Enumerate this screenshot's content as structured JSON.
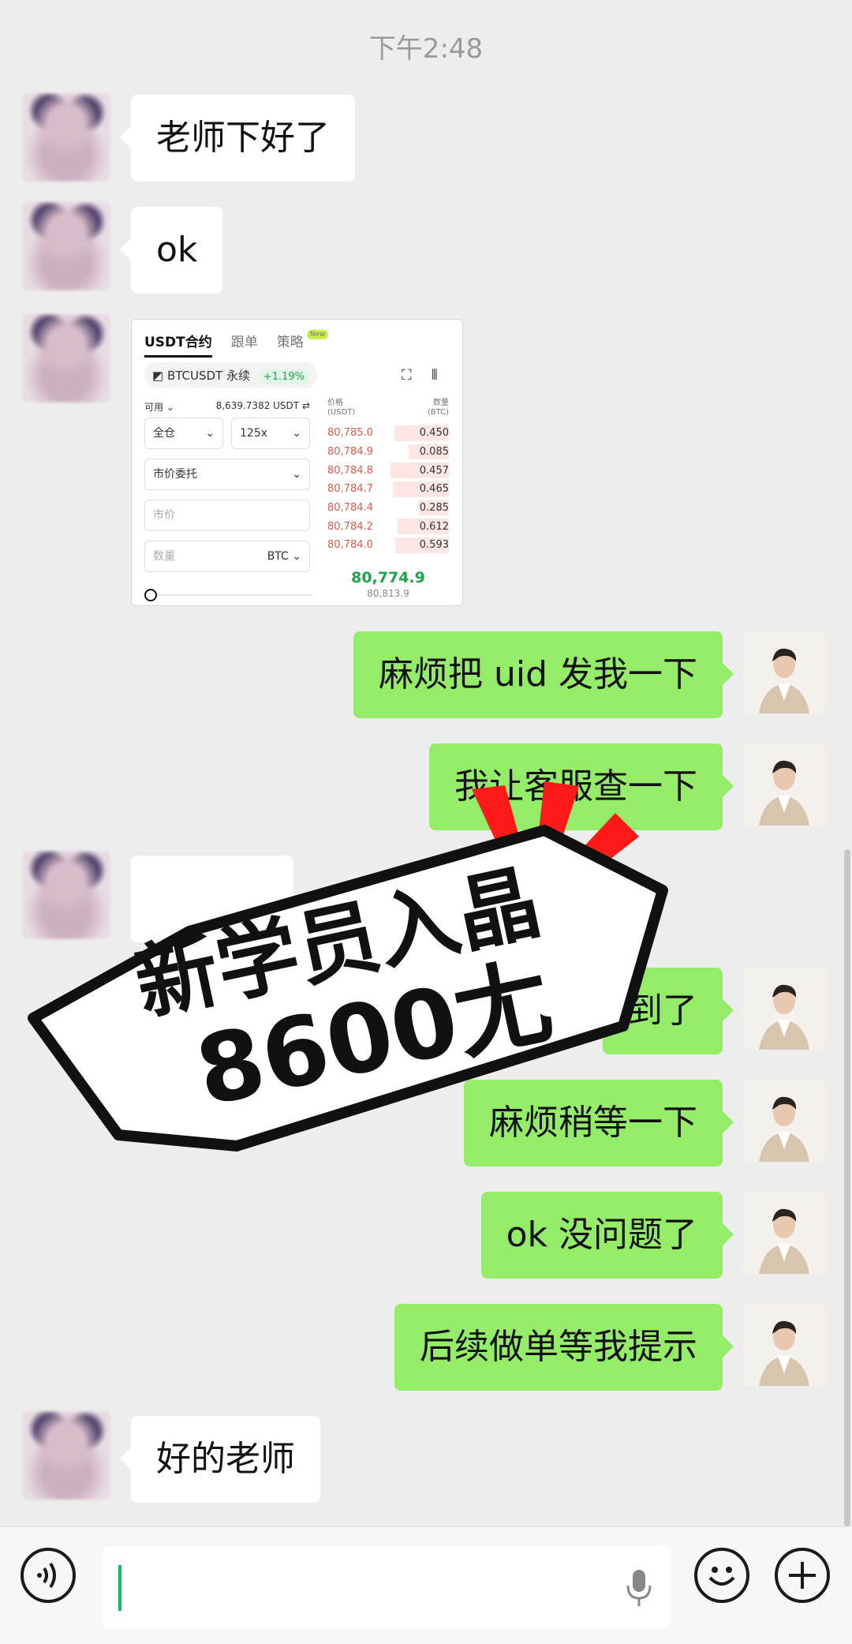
{
  "status": {
    "time": "下午2:48"
  },
  "messages": [
    {
      "side": "in",
      "text": "老师下好了"
    },
    {
      "side": "in",
      "text": "ok"
    },
    {
      "side": "out",
      "text": "麻烦把 uid 发我一下"
    },
    {
      "side": "out",
      "text": "我让客服查一下"
    },
    {
      "side": "out",
      "text": "到了"
    },
    {
      "side": "out",
      "text": "麻烦稍等一下"
    },
    {
      "side": "out",
      "text": "ok 没问题了"
    },
    {
      "side": "out",
      "text": "后续做单等我提示"
    },
    {
      "side": "in",
      "text": "好的老师"
    }
  ],
  "trade_screenshot": {
    "tabs": [
      "USDT合约",
      "跟单",
      "策略"
    ],
    "new_badge": "New",
    "pair": "BTCUSDT",
    "pair_type": "永续",
    "change": "+1.19%",
    "available_label": "可用",
    "available_value": "8,639.7382 USDT",
    "margin_mode": "全仓",
    "leverage": "125x",
    "order_type": "市价委托",
    "price_placeholder": "市价",
    "qty_placeholder": "数量",
    "qty_unit": "BTC",
    "col_price": "价格",
    "col_price_unit": "(USDT)",
    "col_qty": "数量",
    "col_qty_unit": "(BTC)",
    "asks": [
      {
        "price": "80,785.0",
        "qty": "0.450",
        "depth": 0.45
      },
      {
        "price": "80,784.9",
        "qty": "0.085",
        "depth": 0.33
      },
      {
        "price": "80,784.8",
        "qty": "0.457",
        "depth": 0.48
      },
      {
        "price": "80,784.7",
        "qty": "0.465",
        "depth": 0.46
      },
      {
        "price": "80,784.4",
        "qty": "0.285",
        "depth": 0.25
      },
      {
        "price": "80,784.2",
        "qty": "0.612",
        "depth": 0.42
      },
      {
        "price": "80,784.0",
        "qty": "0.593",
        "depth": 0.44
      }
    ],
    "last_price": "80,774.9",
    "mark_price": "80,813.9"
  },
  "overlay": {
    "line1": "新学员入晶",
    "line2": "8600尢",
    "burst_color": "#ff1a1a"
  }
}
